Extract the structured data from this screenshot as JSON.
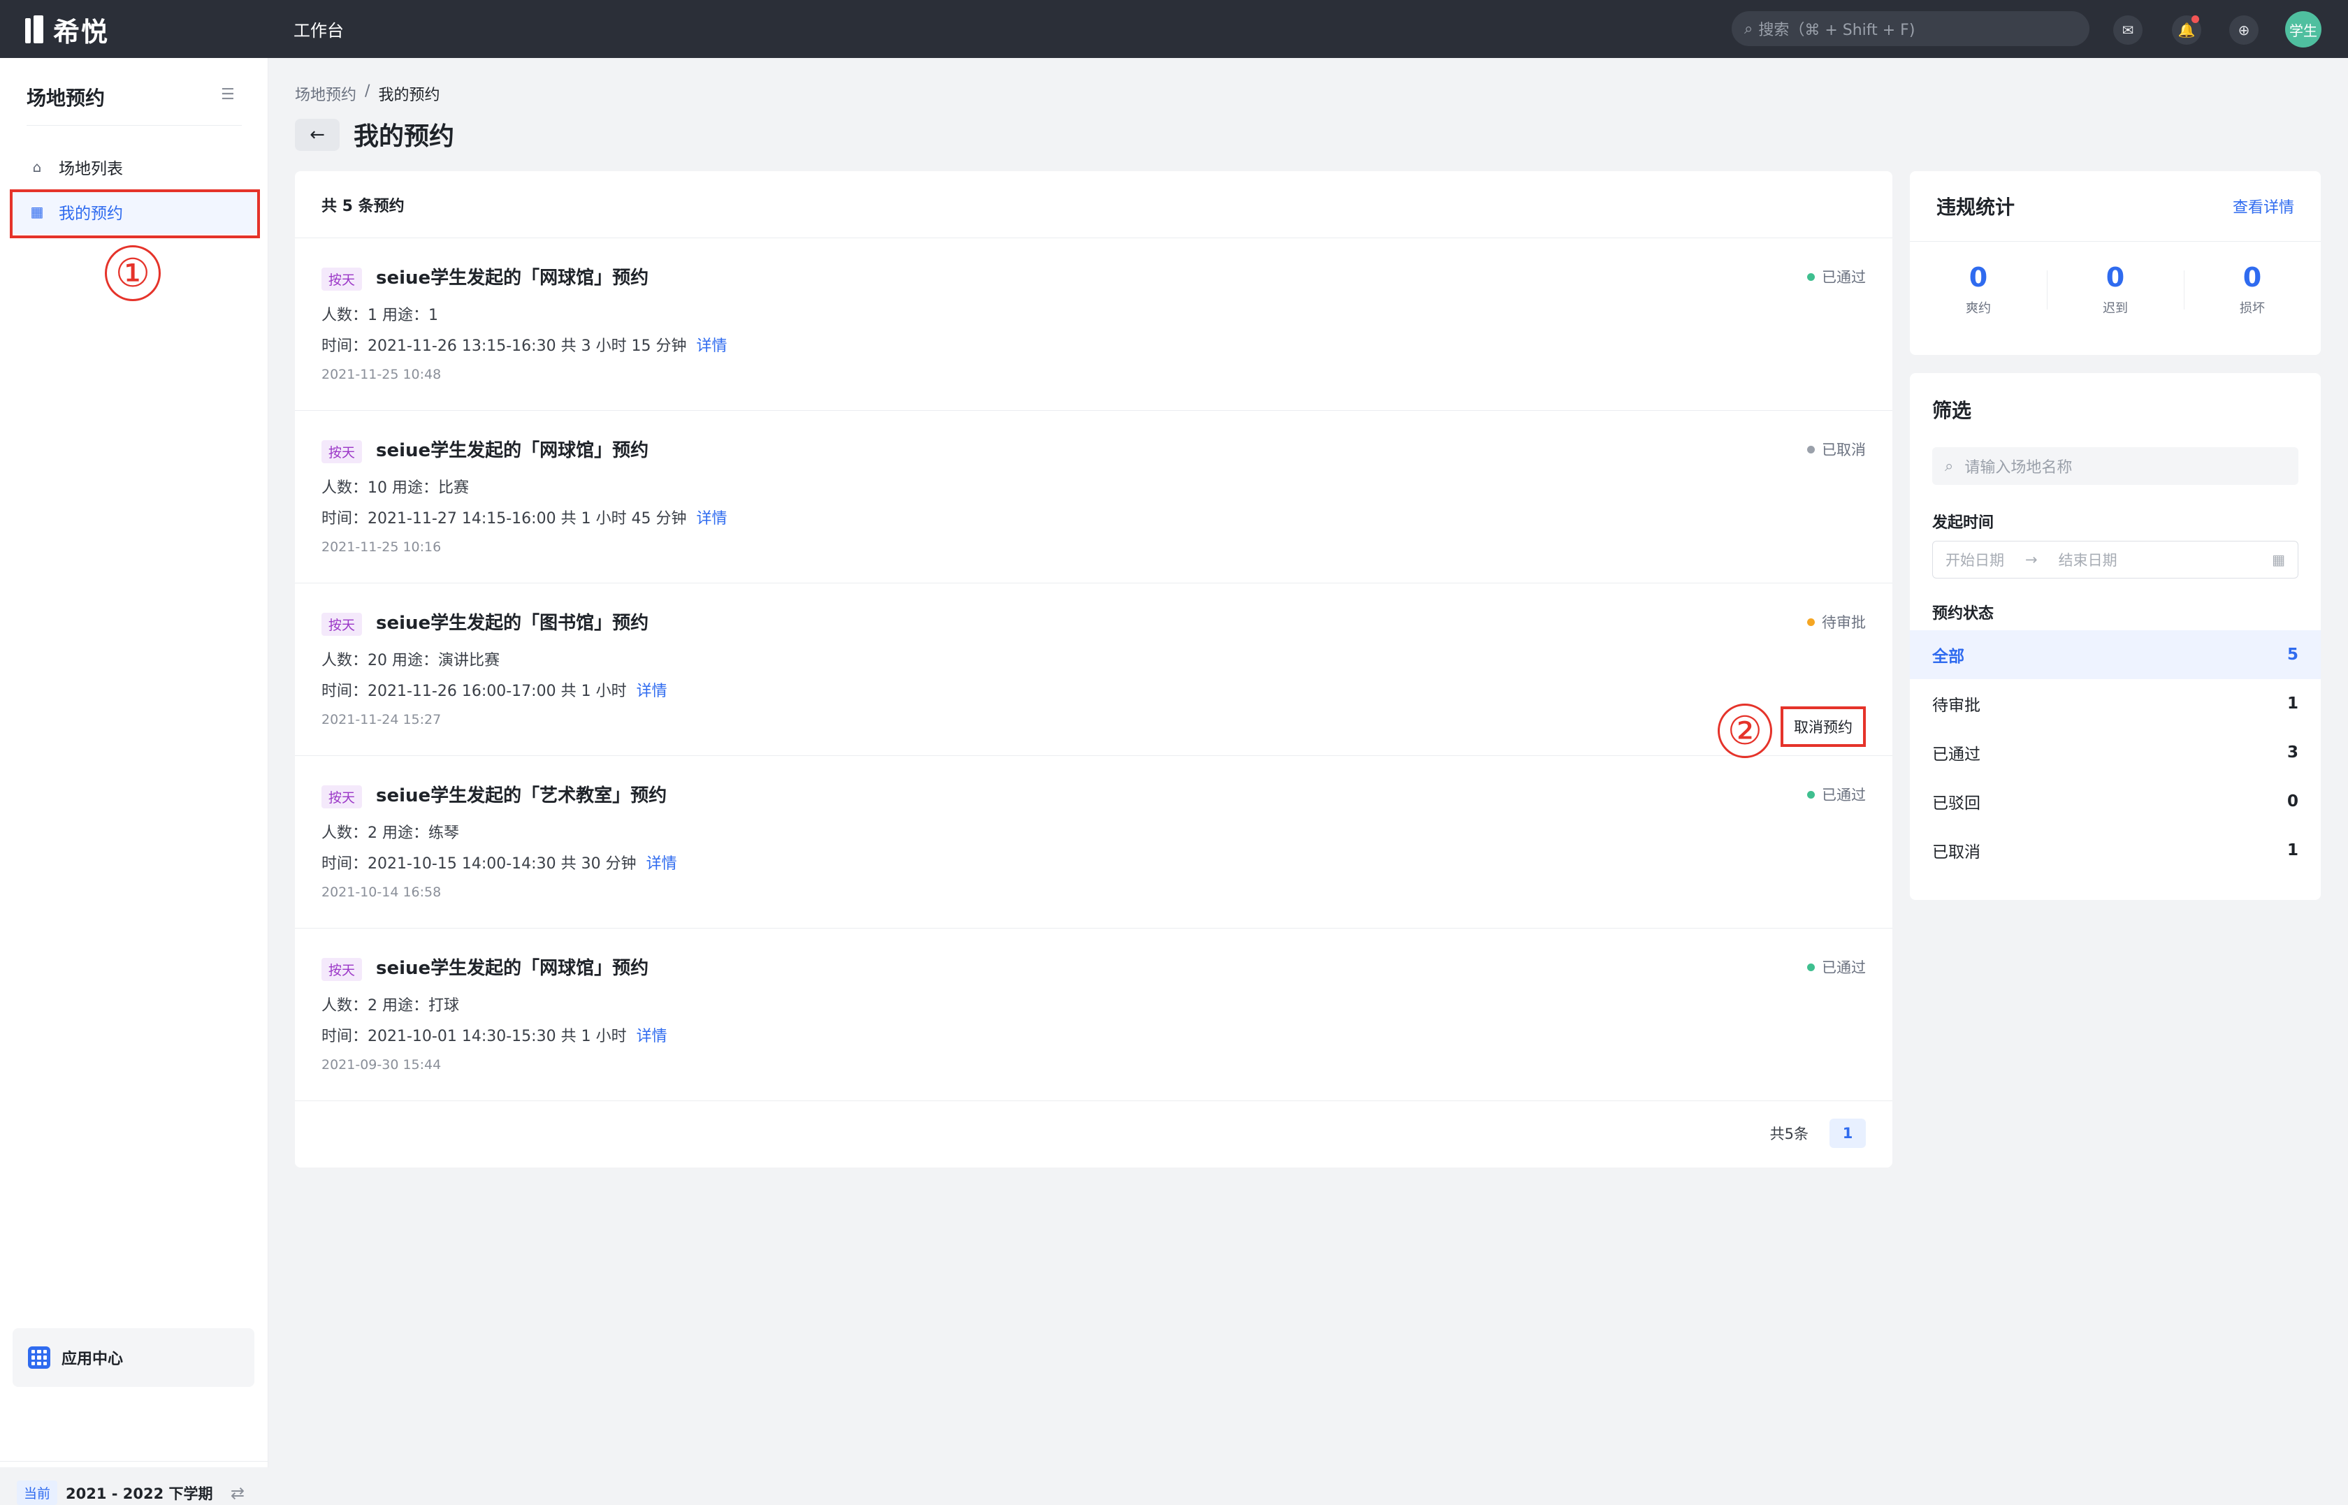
{
  "topbar": {
    "logo": "希悦",
    "workspace": "工作台",
    "search_placeholder": "搜索（⌘ + Shift + F)",
    "avatar": "学生"
  },
  "sidebar": {
    "title": "场地预约",
    "items": [
      {
        "label": "场地列表",
        "icon": "building-icon"
      },
      {
        "label": "我的预约",
        "icon": "calendar-grid-icon"
      }
    ],
    "annotation_1": "①",
    "app_center": "应用中心",
    "term_tag": "当前",
    "term": "2021 - 2022 下学期"
  },
  "breadcrumb": {
    "parent": "场地预约",
    "sep": "/",
    "current": "我的预约"
  },
  "page_title": "我的预约",
  "list": {
    "summary": "共 5 条预约",
    "rows": [
      {
        "tag": "按天",
        "title": "seiue学生发起的「网球馆」预约",
        "meta": "人数：1   用途：1",
        "time": "时间：2021-11-26   13:15-16:30   共 3 小时 15 分钟",
        "detail": "详情",
        "created": "2021-11-25 10:48",
        "status": "已通过",
        "status_color": "#3fbf8f"
      },
      {
        "tag": "按天",
        "title": "seiue学生发起的「网球馆」预约",
        "meta": "人数：10   用途：比赛",
        "time": "时间：2021-11-27   14:15-16:00   共 1 小时 45 分钟",
        "detail": "详情",
        "created": "2021-11-25 10:16",
        "status": "已取消",
        "status_color": "#9aa0aa"
      },
      {
        "tag": "按天",
        "title": "seiue学生发起的「图书馆」预约",
        "meta": "人数：20   用途：演讲比赛",
        "time": "时间：2021-11-26   16:00-17:00   共 1 小时",
        "detail": "详情",
        "created": "2021-11-24 15:27",
        "status": "待审批",
        "status_color": "#f5a623",
        "cancel": "取消预约",
        "annotation_2": "②"
      },
      {
        "tag": "按天",
        "title": "seiue学生发起的「艺术教室」预约",
        "meta": "人数：2   用途：练琴",
        "time": "时间：2021-10-15   14:00-14:30   共 30 分钟",
        "detail": "详情",
        "created": "2021-10-14 16:58",
        "status": "已通过",
        "status_color": "#3fbf8f"
      },
      {
        "tag": "按天",
        "title": "seiue学生发起的「网球馆」预约",
        "meta": "人数：2   用途：打球",
        "time": "时间：2021-10-01   14:30-15:30   共 1 小时",
        "detail": "详情",
        "created": "2021-09-30 15:44",
        "status": "已通过",
        "status_color": "#3fbf8f"
      }
    ],
    "pager_total": "共5条",
    "page": "1"
  },
  "stats": {
    "title": "违规统计",
    "link": "查看详情",
    "cells": [
      {
        "value": "0",
        "label": "爽约"
      },
      {
        "value": "0",
        "label": "迟到"
      },
      {
        "value": "0",
        "label": "损坏"
      }
    ]
  },
  "filter": {
    "title": "筛选",
    "search_placeholder": "请输入场地名称",
    "date_label": "发起时间",
    "start_placeholder": "开始日期",
    "end_placeholder": "结束日期",
    "status_label": "预约状态",
    "statuses": [
      {
        "label": "全部",
        "count": "5"
      },
      {
        "label": "待审批",
        "count": "1"
      },
      {
        "label": "已通过",
        "count": "3"
      },
      {
        "label": "已驳回",
        "count": "0"
      },
      {
        "label": "已取消",
        "count": "1"
      }
    ]
  }
}
